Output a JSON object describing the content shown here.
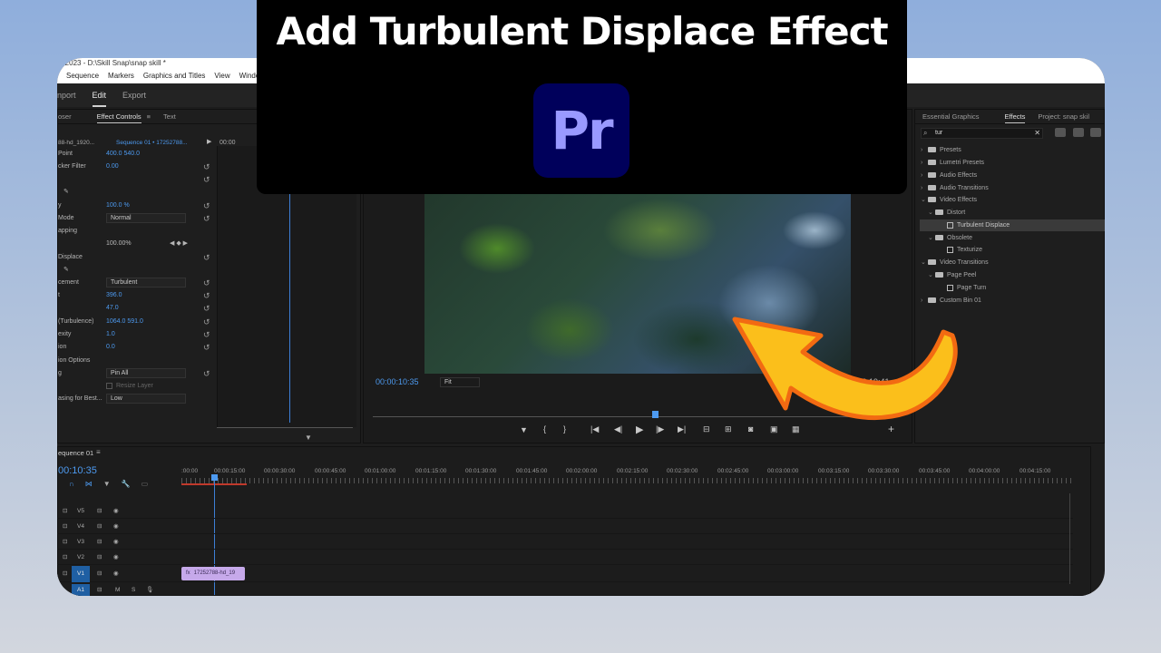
{
  "overlay": {
    "title": "Add Turbulent Displace Effect",
    "logo_text": "Pr"
  },
  "window": {
    "title": "o 2023 - D:\\Skill Snap\\snap skill *"
  },
  "menu": [
    "Sequence",
    "Markers",
    "Graphics and Titles",
    "View",
    "Windo"
  ],
  "workspaces": {
    "import": "nport",
    "edit": "Edit",
    "export": "Export"
  },
  "left_panel": {
    "tabs": [
      "oser",
      "Effect Controls",
      "Text"
    ],
    "source_clip": "88-hd_1920...",
    "sequence": "Sequence 01 • 17252788...",
    "timecode": "00:00",
    "rows": [
      {
        "label": "Point",
        "value": "400.0   540.0"
      },
      {
        "label": "cker Filter",
        "value": "0.00"
      },
      {
        "label": "y",
        "value": "100.0 %"
      },
      {
        "label": "Mode",
        "value": "Normal"
      },
      {
        "label": "apping",
        "value": ""
      },
      {
        "label": "",
        "value": "100.00%"
      },
      {
        "label": "Displace",
        "value": ""
      },
      {
        "label": "cement",
        "value": "Turbulent"
      },
      {
        "label": "t",
        "value": "396.0"
      },
      {
        "label": "",
        "value": "47.0"
      },
      {
        "label": "(Turbulence)",
        "value": "1064.0    591.0"
      },
      {
        "label": "exity",
        "value": "1.0"
      },
      {
        "label": "ion",
        "value": "0.0"
      },
      {
        "label": "ion Options",
        "value": ""
      },
      {
        "label": "g",
        "value": "Pin All"
      },
      {
        "label": "",
        "value": "Resize Layer"
      },
      {
        "label": "asing for Best...",
        "value": "Low"
      }
    ]
  },
  "program": {
    "timecode_current": "00:00:10:35",
    "fit": "Fit",
    "timecode_end": "00:00:19:41"
  },
  "effects_panel": {
    "tabs": [
      "Essential Graphics",
      "Effects",
      "Project: snap skil"
    ],
    "search": "tur",
    "items": [
      {
        "label": "Presets",
        "level": 0,
        "type": "folder",
        "open": false
      },
      {
        "label": "Lumetri Presets",
        "level": 0,
        "type": "folder",
        "open": false
      },
      {
        "label": "Audio Effects",
        "level": 0,
        "type": "folder",
        "open": false
      },
      {
        "label": "Audio Transitions",
        "level": 0,
        "type": "folder",
        "open": false
      },
      {
        "label": "Video Effects",
        "level": 0,
        "type": "folder",
        "open": true
      },
      {
        "label": "Distort",
        "level": 1,
        "type": "folder",
        "open": true
      },
      {
        "label": "Turbulent Displace",
        "level": 2,
        "type": "effect",
        "selected": true
      },
      {
        "label": "Obsolete",
        "level": 1,
        "type": "folder",
        "open": true
      },
      {
        "label": "Texturize",
        "level": 2,
        "type": "effect"
      },
      {
        "label": "Video Transitions",
        "level": 0,
        "type": "folder",
        "open": true
      },
      {
        "label": "Page Peel",
        "level": 1,
        "type": "folder",
        "open": true
      },
      {
        "label": "Page Turn",
        "level": 2,
        "type": "effect"
      },
      {
        "label": "Custom Bin 01",
        "level": 0,
        "type": "folder",
        "open": false
      }
    ]
  },
  "timeline": {
    "sequence_name": "equence 01",
    "timecode": "00:10:35",
    "ruler": [
      ":00:00",
      "00:00:15:00",
      "00:00:30:00",
      "00:00:45:00",
      "00:01:00:00",
      "00:01:15:00",
      "00:01:30:00",
      "00:01:45:00",
      "00:02:00:00",
      "00:02:15:00",
      "00:02:30:00",
      "00:02:45:00",
      "00:03:00:00",
      "00:03:15:00",
      "00:03:30:00",
      "00:03:45:00",
      "00:04:00:00",
      "00:04:15:00"
    ],
    "tracks": [
      "V5",
      "V4",
      "V3",
      "V2",
      "V1",
      "A1"
    ],
    "clip_label": "17252788-hd_19"
  },
  "colors": {
    "accent_blue": "#4d9af0",
    "arrow_fill": "#fbbf1b",
    "arrow_stroke": "#f26a12",
    "clip": "#c6a9ea"
  }
}
